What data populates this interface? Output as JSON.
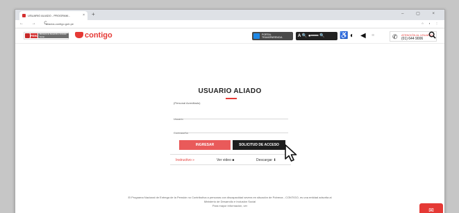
{
  "browser": {
    "tab_title": "USUARIO ALIADO - PROGRAM...",
    "tab_close": "×",
    "new_tab": "+",
    "window_controls": "–  ▢  ×",
    "nav_buttons": "←  →  C",
    "url": "aliados.contigo.gob.pe",
    "right_controls": "☆  ◐  ⋮"
  },
  "header": {
    "peru_label": "PERÚ",
    "ministry_label": "Ministerio de Desarrollo e Inclusión Social",
    "brand_name": "contigo",
    "portal_label_1": "PORTAL",
    "portal_label_2": "TRANSPARENCIA",
    "accessibility_text": "A  🔍 ●━━━ 🔍",
    "call_label": "ATENCIÓN AL USUARIO",
    "call_number": "(01) 644 9006",
    "search_icon": "search-icon",
    "accent_color": "#e53935"
  },
  "login": {
    "title": "USUARIO ALIADO",
    "note": "(Personal Acreditado)",
    "user_placeholder": "Usuario",
    "password_placeholder": "Contraseña",
    "ingresar_label": "INGRESAR",
    "solicitud_label": "SOLICITUD DE ACCESO"
  },
  "links": {
    "instructivo": "Instructivo »",
    "ver_video": "Ver video ■",
    "descargar": "Descargar ⬇"
  },
  "footer": {
    "line1": "El Programa Nacional de Entrega de la Pensión no Contributiva a personas con discapacidad severa en situación de Pobreza - CONTIGO, es una entidad adscrita al",
    "line2": "Ministerio de Desarrollo e Inclusión Social",
    "line3": "Para mayor información, ver"
  }
}
